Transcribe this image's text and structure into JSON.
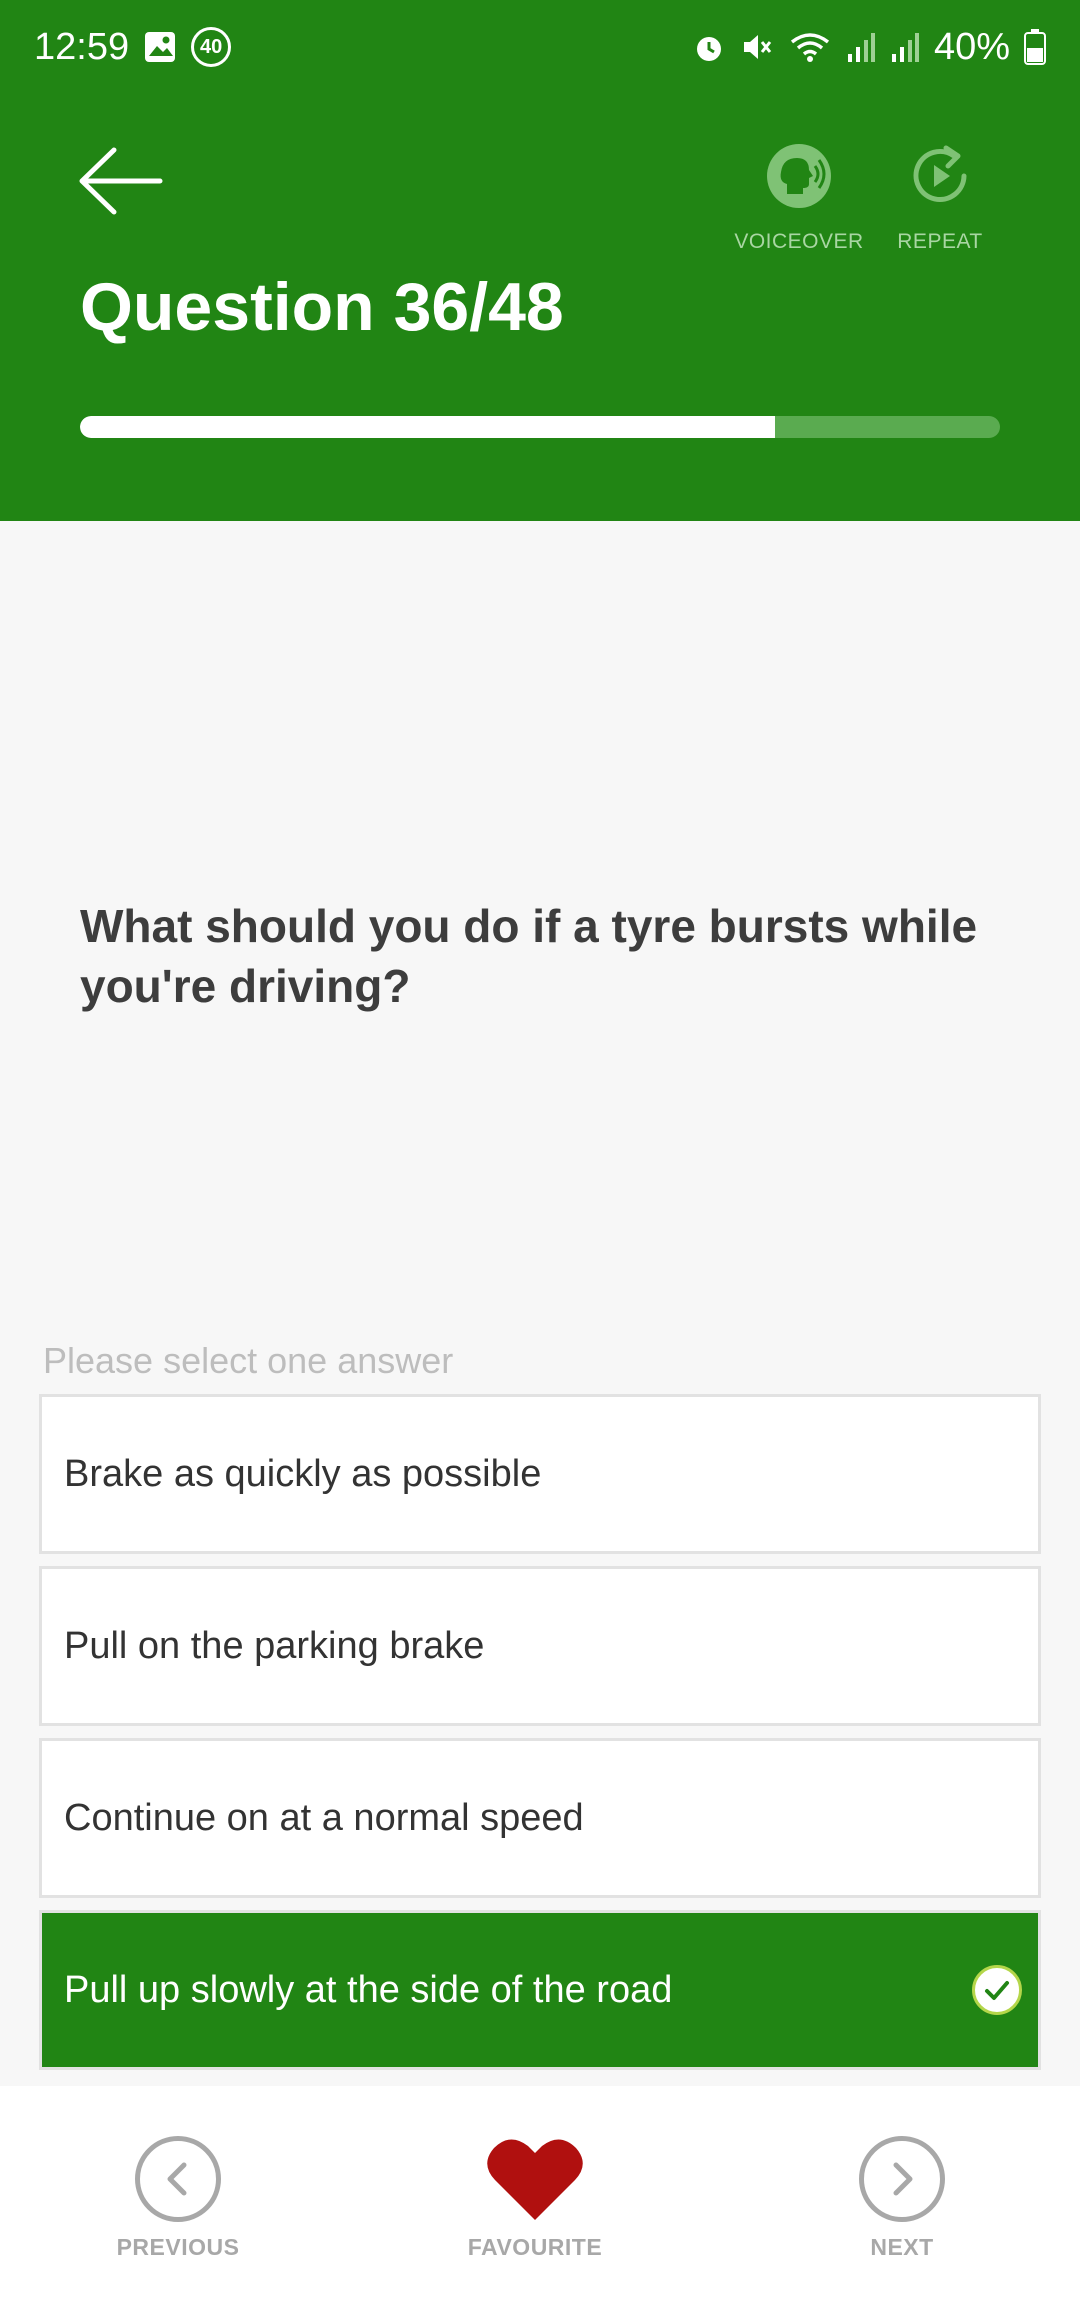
{
  "status_bar": {
    "time": "12:59",
    "badge": "40",
    "battery": "40%"
  },
  "header": {
    "title": "Question 36/48",
    "progress": {
      "current": 36,
      "total": 48,
      "fraction": 0.755
    },
    "tools": [
      {
        "label": "VOICEOVER",
        "icon": "voiceover-icon"
      },
      {
        "label": "REPEAT",
        "icon": "repeat-icon"
      }
    ],
    "colors": {
      "brand_green": "#218514"
    }
  },
  "question": {
    "text": "What should you do if a tyre bursts while you're driving?",
    "prompt": "Please select one answer"
  },
  "answers": [
    {
      "label": "Brake as quickly as possible",
      "selected": false
    },
    {
      "label": "Pull on the parking brake",
      "selected": false
    },
    {
      "label": "Continue on at a normal speed",
      "selected": false
    },
    {
      "label": "Pull up slowly at the side of the road",
      "selected": true
    }
  ],
  "bottom_nav": {
    "previous": "PREVIOUS",
    "favourite": "FAVOURITE",
    "next": "NEXT",
    "favourite_color": "#b0100f"
  }
}
